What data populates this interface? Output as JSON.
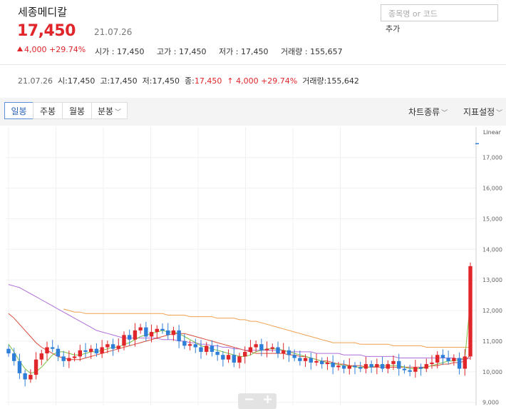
{
  "stock": {
    "name": "세종메디칼",
    "price": "17,450",
    "date": "21.07.26",
    "change": "4,000",
    "change_pct": "+29.74%",
    "open_label": "시가",
    "open": "17,450",
    "high_label": "고가",
    "high": "17,450",
    "low_label": "저가",
    "low": "17,450",
    "volume_label": "거래량",
    "volume": "155,657"
  },
  "search": {
    "placeholder": "종목명 or 코드",
    "add_label": "추가"
  },
  "summary": {
    "date": "21.07.26",
    "o_label": "시",
    "o": "17,450",
    "h_label": "고",
    "h": "17,450",
    "l_label": "저",
    "l": "17,450",
    "c_label": "종",
    "c": "17,450",
    "chg": "↑ 4,000",
    "pct": "+29.74%",
    "vol_label": "거래량",
    "vol": "155,642"
  },
  "toolbar": {
    "tabs": [
      "일봉",
      "주봉",
      "월봉",
      "분봉"
    ],
    "chart_type_label": "차트종류",
    "indicator_label": "지표설정"
  },
  "colors": {
    "up": "#e0262a",
    "down": "#2f7fd8",
    "ma5": "#7bc043",
    "ma20": "#d94a3a",
    "ma60": "#b06fd8",
    "ma120": "#f0a050"
  },
  "chart_data": {
    "type": "candlestick",
    "scale_label": "Linear",
    "y_ticks": [
      "17,000",
      "16,000",
      "15,000",
      "14,000",
      "13,000",
      "12,000",
      "11,000",
      "10,000",
      "9,000"
    ],
    "y_range": [
      8900,
      17900
    ],
    "closes": [
      10600,
      10350,
      9950,
      9750,
      9900,
      10400,
      10600,
      10800,
      10750,
      10500,
      10350,
      10450,
      10500,
      10700,
      10650,
      10750,
      10600,
      10800,
      10900,
      10750,
      10850,
      11200,
      11050,
      11350,
      11450,
      11150,
      11300,
      11400,
      11350,
      11200,
      11350,
      11000,
      10850,
      10900,
      10800,
      10650,
      10850,
      10650,
      10550,
      10400,
      10550,
      10300,
      10500,
      10650,
      10800,
      10900,
      10700,
      10750,
      10800,
      10600,
      10700,
      10550,
      10450,
      10350,
      10450,
      10300,
      10350,
      10250,
      10300,
      10150,
      10200,
      10100,
      10200,
      10150,
      10100,
      10250,
      10150,
      10250,
      10100,
      10250,
      10350,
      10100,
      10050,
      10000,
      10150,
      10100,
      10250,
      10300,
      10550,
      10450,
      10350,
      10450,
      10100,
      10500,
      13450
    ],
    "ma5": [
      10900,
      10650,
      10350,
      10100,
      9950,
      10000,
      10150,
      10350,
      10550,
      10650,
      10650,
      10600,
      10550,
      10550,
      10600,
      10650,
      10650,
      10700,
      10750,
      10800,
      10800,
      10900,
      10950,
      11050,
      11150,
      11200,
      11250,
      11300,
      11350,
      11300,
      11300,
      11250,
      11150,
      11050,
      10950,
      10850,
      10800,
      10750,
      10700,
      10650,
      10600,
      10550,
      10500,
      10500,
      10550,
      10650,
      10700,
      10750,
      10750,
      10750,
      10700,
      10650,
      10600,
      10550,
      10500,
      10450,
      10400,
      10350,
      10300,
      10250,
      10250,
      10200,
      10200,
      10150,
      10150,
      10150,
      10150,
      10200,
      10200,
      10200,
      10200,
      10200,
      10150,
      10100,
      10100,
      10100,
      10150,
      10200,
      10250,
      10300,
      10350,
      10350,
      10400,
      10450,
      12300
    ],
    "ma20": [
      11900,
      11750,
      11550,
      11350,
      11150,
      10950,
      10800,
      10700,
      10600,
      10500,
      10450,
      10400,
      10400,
      10400,
      10450,
      10500,
      10550,
      10600,
      10650,
      10700,
      10750,
      10800,
      10850,
      10900,
      10950,
      11000,
      11050,
      11100,
      11150,
      11200,
      11250,
      11250,
      11250,
      11200,
      11150,
      11100,
      11050,
      11000,
      10950,
      10900,
      10850,
      10800,
      10750,
      10700,
      10650,
      10600,
      10600,
      10600,
      10600,
      10600,
      10600,
      10550,
      10550,
      10500,
      10500,
      10450,
      10400,
      10350,
      10350,
      10300,
      10250,
      10250,
      10200,
      10200,
      10200,
      10150,
      10150,
      10150,
      10150,
      10150,
      10150,
      10150,
      10150,
      10150,
      10150,
      10150,
      10150,
      10200,
      10200,
      10250,
      10250,
      10300,
      10300,
      10350,
      10550
    ],
    "ma60": [
      12850,
      12800,
      12750,
      12650,
      12550,
      12450,
      12350,
      12250,
      12150,
      12050,
      11950,
      11850,
      11750,
      11650,
      11550,
      11450,
      11350,
      11300,
      11250,
      11200,
      11150,
      11100,
      11100,
      11100,
      11100,
      11100,
      11100,
      11100,
      11050,
      11050,
      11050,
      11000,
      11000,
      10950,
      10950,
      10900,
      10900,
      10850,
      10850,
      10800,
      10800,
      10750,
      10750,
      10700,
      10700,
      10700,
      10700,
      10700,
      10700,
      10700,
      10700,
      10650,
      10650,
      10650,
      10650,
      10650,
      10600,
      10600,
      10600,
      10600,
      10600,
      10550,
      10550,
      10550,
      10550,
      10500,
      10500,
      10500,
      10500,
      10500,
      10500,
      10450,
      10450,
      10450,
      10450,
      10450,
      10450,
      10450,
      10450,
      10450,
      10450,
      10450,
      10400,
      10400,
      10450
    ],
    "ma120_start": 10,
    "ma120": [
      12050,
      12000,
      11950,
      11950,
      11900,
      11900,
      11900,
      11900,
      11900,
      11900,
      11900,
      11900,
      11900,
      11900,
      11900,
      11900,
      11900,
      11900,
      11900,
      11850,
      11850,
      11850,
      11850,
      11800,
      11800,
      11800,
      11800,
      11800,
      11750,
      11750,
      11750,
      11750,
      11700,
      11700,
      11650,
      11650,
      11600,
      11550,
      11500,
      11450,
      11400,
      11350,
      11300,
      11250,
      11200,
      11150,
      11100,
      11050,
      11000,
      10950,
      10950,
      10950,
      10950,
      10950,
      10900,
      10900,
      10900,
      10900,
      10900,
      10900,
      10850,
      10850,
      10850,
      10850,
      10850,
      10850,
      10800,
      10800,
      10800,
      10800,
      10800,
      10800,
      10800,
      10800,
      10800
    ]
  }
}
